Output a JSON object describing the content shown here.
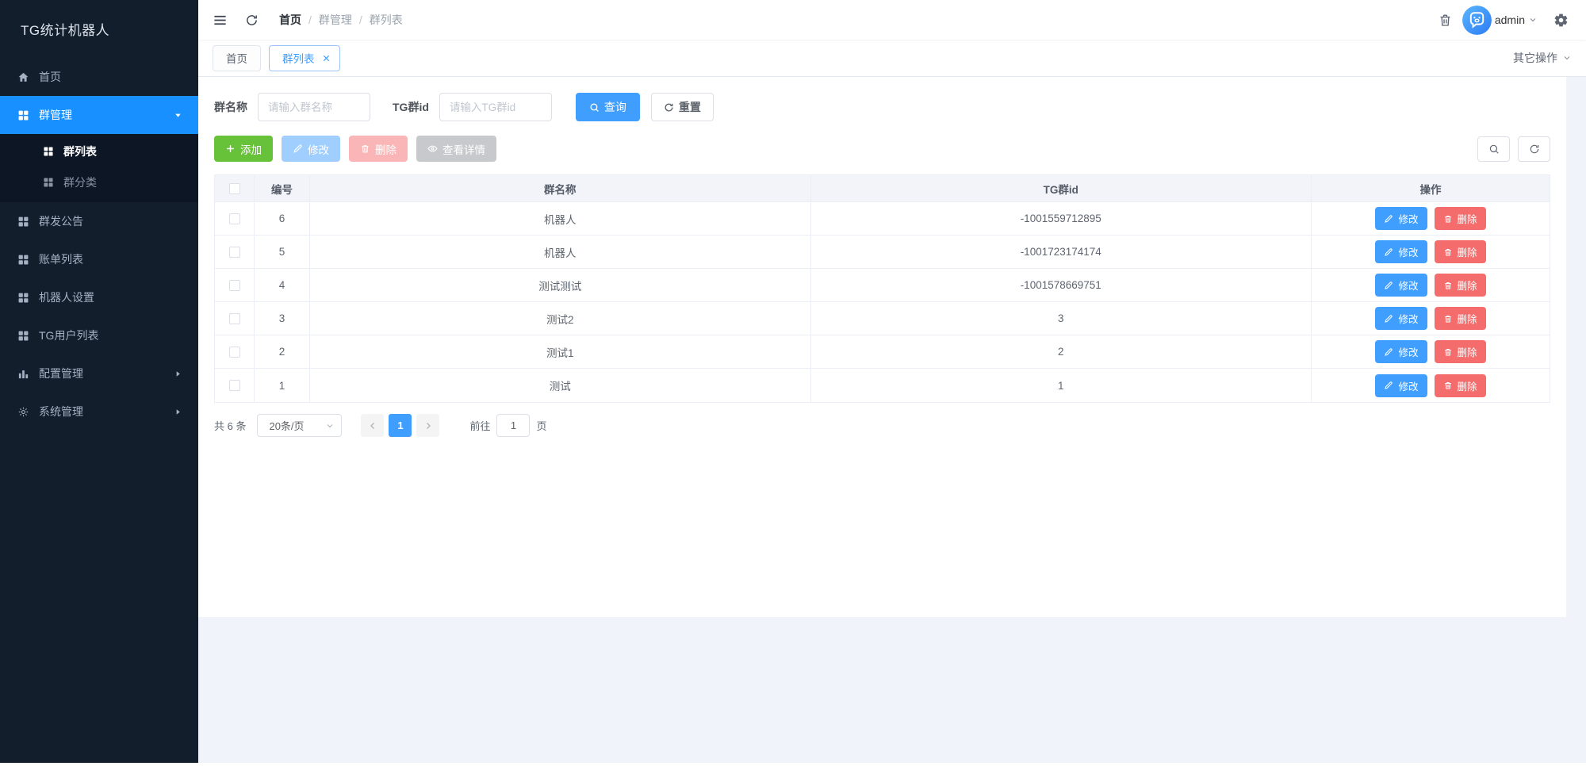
{
  "app": {
    "title": "TG统计机器人"
  },
  "colors": {
    "sidebar_bg": "#131e2d",
    "sidebar_active": "#1890ff",
    "accent": "#409eff",
    "success": "#67c23a",
    "danger": "#f56c6c",
    "content_bg": "#f0f3fa"
  },
  "sidebar": {
    "logo": "TG统计机器人",
    "items": [
      {
        "label": "首页",
        "icon": "home-icon",
        "active": false
      },
      {
        "label": "群管理",
        "icon": "grid-icon",
        "active": true,
        "expanded": true,
        "children": [
          {
            "label": "群列表",
            "icon": "grid-icon",
            "active": true
          },
          {
            "label": "群分类",
            "icon": "grid-icon",
            "active": false
          }
        ]
      },
      {
        "label": "群发公告",
        "icon": "grid-icon",
        "active": false
      },
      {
        "label": "账单列表",
        "icon": "grid-icon",
        "active": false
      },
      {
        "label": "机器人设置",
        "icon": "grid-icon",
        "active": false
      },
      {
        "label": "TG用户列表",
        "icon": "grid-icon",
        "active": false
      },
      {
        "label": "配置管理",
        "icon": "bar-chart-icon",
        "active": false,
        "collapsed": true
      },
      {
        "label": "系统管理",
        "icon": "gear-icon",
        "active": false,
        "collapsed": true
      }
    ]
  },
  "navbar": {
    "breadcrumb": [
      "首页",
      "群管理",
      "群列表"
    ],
    "separator": "/",
    "user": "admin"
  },
  "tabbar": {
    "tabs": [
      {
        "label": "首页",
        "active": false
      },
      {
        "label": "群列表",
        "active": true,
        "closable": true
      }
    ],
    "more_label": "其它操作"
  },
  "search": {
    "fields": [
      {
        "label": "群名称",
        "placeholder": "请输入群名称",
        "value": ""
      },
      {
        "label": "TG群id",
        "placeholder": "请输入TG群id",
        "value": ""
      }
    ],
    "query_label": "查询",
    "reset_label": "重置"
  },
  "toolbar": {
    "add_label": "添加",
    "edit_label": "修改",
    "delete_label": "删除",
    "detail_label": "查看详情"
  },
  "table": {
    "headers": [
      "编号",
      "群名称",
      "TG群id",
      "操作"
    ],
    "row_edit_label": "修改",
    "row_delete_label": "删除",
    "rows": [
      {
        "id": "6",
        "name": "机器人",
        "tgid": "-1001559712895"
      },
      {
        "id": "5",
        "name": "机器人",
        "tgid": "-1001723174174"
      },
      {
        "id": "4",
        "name": "测试测试",
        "tgid": "-1001578669751"
      },
      {
        "id": "3",
        "name": "测试2",
        "tgid": "3"
      },
      {
        "id": "2",
        "name": "测试1",
        "tgid": "2"
      },
      {
        "id": "1",
        "name": "测试",
        "tgid": "1"
      }
    ]
  },
  "pagination": {
    "total": "共 6 条",
    "page_size": "20条/页",
    "current_page": "1",
    "goto_label": "前往",
    "goto_value": "1",
    "page_unit": "页"
  }
}
